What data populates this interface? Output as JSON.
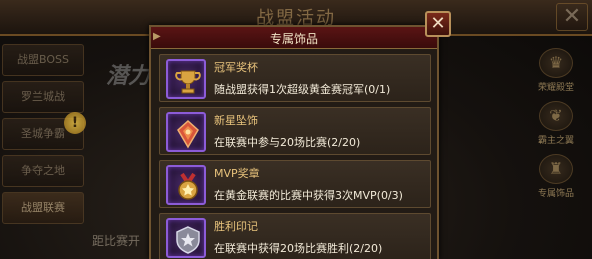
{
  "background": {
    "title": "战盟活动",
    "close_glyph": "✕",
    "tabs": [
      {
        "label": "战盟BOSS"
      },
      {
        "label": "罗兰城战"
      },
      {
        "label": "圣城争霸"
      },
      {
        "label": "争夺之地"
      },
      {
        "label": "战盟联赛"
      }
    ],
    "alert_glyph": "!",
    "hero_text": "潜力",
    "bottom_text": "距比赛开",
    "side_items": [
      {
        "label": "荣耀殿堂",
        "icon": "crown-icon"
      },
      {
        "label": "霸主之翼",
        "icon": "wing-icon"
      },
      {
        "label": "专属饰品",
        "icon": "trophy-icon"
      }
    ]
  },
  "popup": {
    "title": "专属饰品",
    "close_glyph": "✕",
    "items": [
      {
        "name": "冠军奖杯",
        "desc": "随战盟获得1次超级黄金赛冠军(0/1)",
        "icon": "trophy-icon",
        "color": "#d9a441"
      },
      {
        "name": "新星坠饰",
        "desc": "在联赛中参与20场比赛(2/20)",
        "icon": "pendant-icon",
        "color": "#d9553a"
      },
      {
        "name": "MVP奖章",
        "desc": "在黄金联赛的比赛中获得3次MVP(0/3)",
        "icon": "medal-icon",
        "color": "#d9a441"
      },
      {
        "name": "胜利印记",
        "desc": "在联赛中获得20场比赛胜利(2/20)",
        "icon": "emblem-icon",
        "color": "#b8b8c8"
      }
    ]
  },
  "colors": {
    "accent_gold": "#e8c37c",
    "header_red": "#5a1414",
    "icon_frame_purple": "#8c5cd8"
  }
}
